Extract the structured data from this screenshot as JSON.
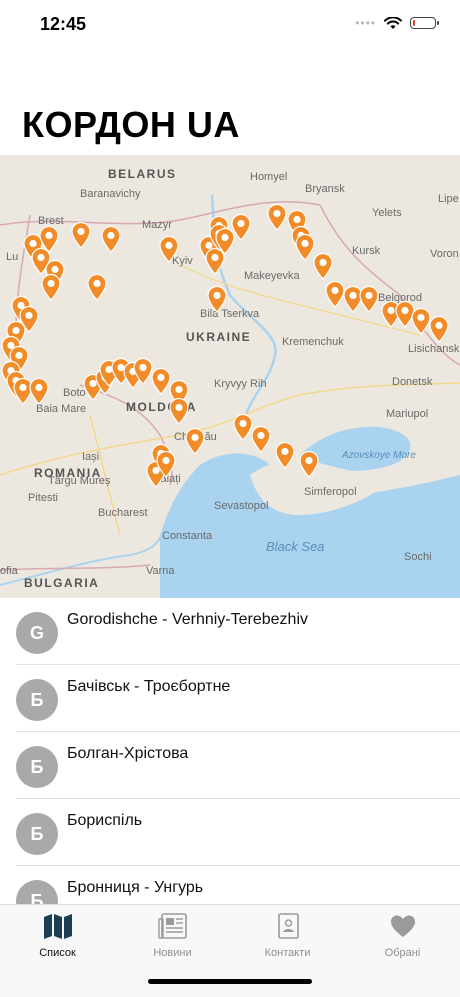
{
  "status_bar": {
    "time": "12:45",
    "battery_level": 0.12,
    "battery_color": "#e53935"
  },
  "header": {
    "title": "КОРДОН UA"
  },
  "map": {
    "pin_color": "#f28c28",
    "land_color": "#ede8df",
    "water_color": "#a9d3ef",
    "place_labels": [
      {
        "name": "BELARUS",
        "kind": "country"
      },
      {
        "name": "Baranavichy",
        "kind": "city"
      },
      {
        "name": "Bryansk",
        "kind": "city"
      },
      {
        "name": "Brest",
        "kind": "city"
      },
      {
        "name": "Mazyr",
        "kind": "city"
      },
      {
        "name": "Homyel",
        "kind": "city"
      },
      {
        "name": "Yelets",
        "kind": "city"
      },
      {
        "name": "Lipe",
        "kind": "city"
      },
      {
        "name": "Kursk",
        "kind": "city"
      },
      {
        "name": "Voron",
        "kind": "city"
      },
      {
        "name": "Lu",
        "kind": "city"
      },
      {
        "name": "Kyiv",
        "kind": "city"
      },
      {
        "name": "Makeyevka",
        "kind": "city"
      },
      {
        "name": "Bila Tserkva",
        "kind": "city"
      },
      {
        "name": "Belgorod",
        "kind": "city"
      },
      {
        "name": "UKRAINE",
        "kind": "country"
      },
      {
        "name": "Kremenchuk",
        "kind": "city"
      },
      {
        "name": "Lisichansk",
        "kind": "city"
      },
      {
        "name": "Boto",
        "kind": "city"
      },
      {
        "name": "MOLDOVA",
        "kind": "country"
      },
      {
        "name": "Kryvyy Rih",
        "kind": "city"
      },
      {
        "name": "Donetsk",
        "kind": "city"
      },
      {
        "name": "Baia Mare",
        "kind": "city"
      },
      {
        "name": "Mariupol",
        "kind": "city"
      },
      {
        "name": "Iași",
        "kind": "city"
      },
      {
        "name": "Chișinău",
        "kind": "city"
      },
      {
        "name": "Azovskoye More",
        "kind": "sea-small"
      },
      {
        "name": "Târgu Mureș",
        "kind": "city"
      },
      {
        "name": "ROMANIA",
        "kind": "country"
      },
      {
        "name": "Galați",
        "kind": "city"
      },
      {
        "name": "Simferopol",
        "kind": "city"
      },
      {
        "name": "Pitesti",
        "kind": "city"
      },
      {
        "name": "Sevastopol",
        "kind": "city"
      },
      {
        "name": "Bucharest",
        "kind": "city"
      },
      {
        "name": "Constanta",
        "kind": "city"
      },
      {
        "name": "Black Sea",
        "kind": "sea"
      },
      {
        "name": "Sochi",
        "kind": "city"
      },
      {
        "name": "Varna",
        "kind": "city"
      },
      {
        "name": "ofia",
        "kind": "city"
      },
      {
        "name": "BULGARIA",
        "kind": "country"
      }
    ]
  },
  "list": {
    "items": [
      {
        "initial": "G",
        "name": "Gorodishche - Verhniy-Terebezhiv"
      },
      {
        "initial": "Б",
        "name": "Бачівськ - Троєбортне"
      },
      {
        "initial": "Б",
        "name": "Болган-Хрістова"
      },
      {
        "initial": "Б",
        "name": "Бориспіль"
      },
      {
        "initial": "Б",
        "name": "Бронниця - Унгурь"
      }
    ]
  },
  "tabs": [
    {
      "label": "Список",
      "icon": "map-icon",
      "active": true
    },
    {
      "label": "Новини",
      "icon": "newspaper-icon",
      "active": false
    },
    {
      "label": "Контакти",
      "icon": "contact-card-icon",
      "active": false
    },
    {
      "label": "Обрані",
      "icon": "heart-icon",
      "active": false
    }
  ]
}
